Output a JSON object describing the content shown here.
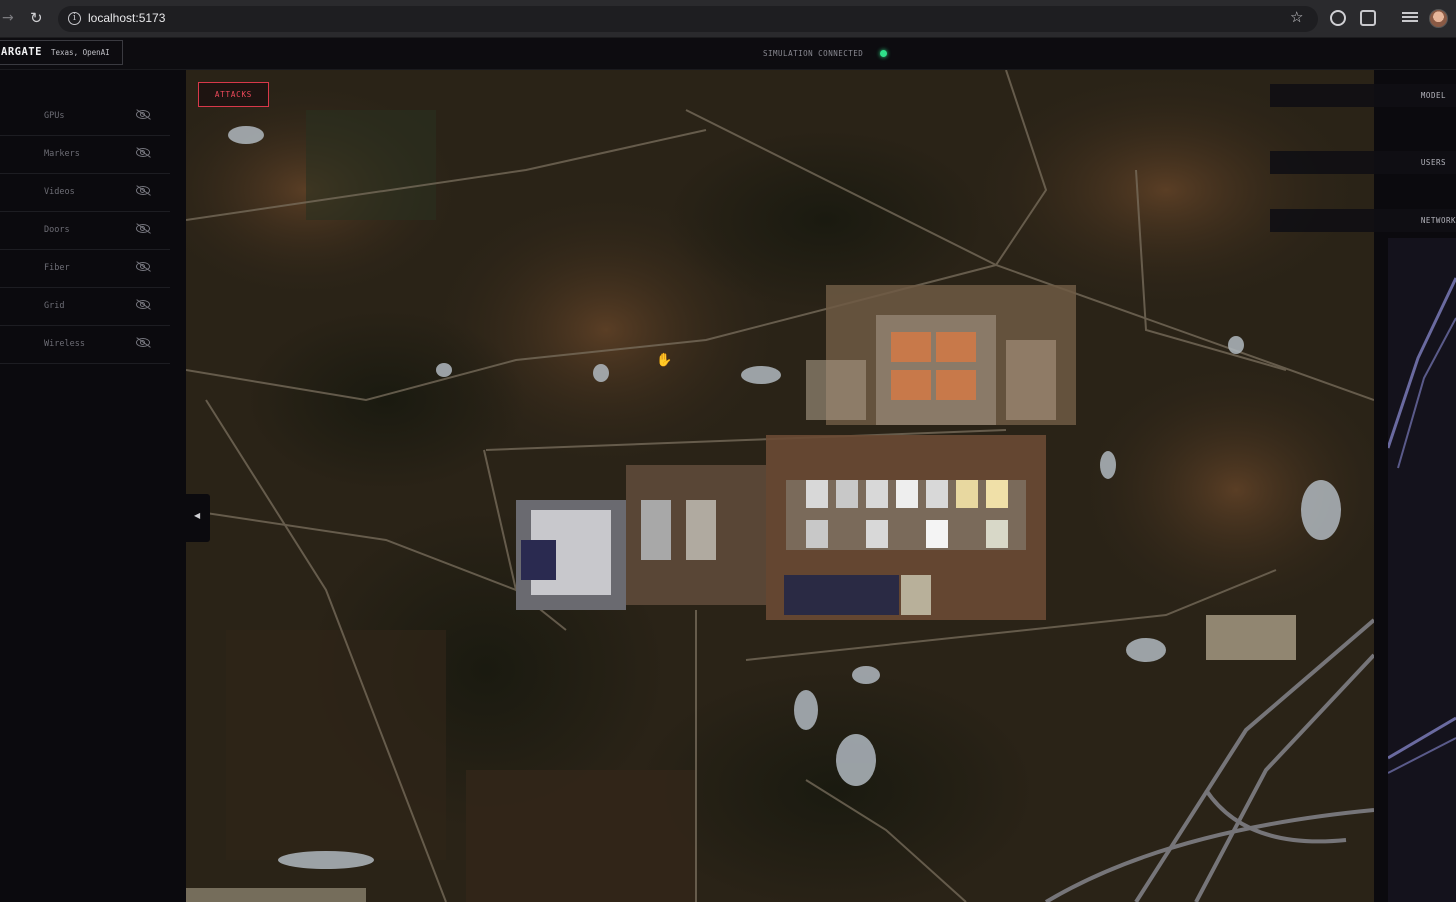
{
  "browser": {
    "url": "localhost:5173",
    "icons": [
      "forward-icon",
      "reload-icon",
      "info-icon",
      "star-icon",
      "extension-icon",
      "puzzle-icon",
      "reading-list-icon",
      "avatar"
    ]
  },
  "header": {
    "brand": "ARGATE",
    "location": "Texas, OpenAI",
    "status": "SIMULATION CONNECTED",
    "status_color": "#2fe08a"
  },
  "sidebar": {
    "layers": [
      {
        "label": "GPUs",
        "icon": "eye-off-icon"
      },
      {
        "label": "Markers",
        "icon": "eye-off-icon"
      },
      {
        "label": "Videos",
        "icon": "eye-off-icon"
      },
      {
        "label": "Doors",
        "icon": "eye-off-icon"
      },
      {
        "label": "Fiber",
        "icon": "eye-off-icon"
      },
      {
        "label": "Grid",
        "icon": "eye-off-icon"
      },
      {
        "label": "Wireless",
        "icon": "eye-off-icon"
      }
    ]
  },
  "map": {
    "attacks_label": "ATTACKS",
    "attacks_color": "#ef4a5b"
  },
  "right_panel": {
    "tabs": [
      "MODEL",
      "USERS",
      "NETWORK"
    ]
  }
}
